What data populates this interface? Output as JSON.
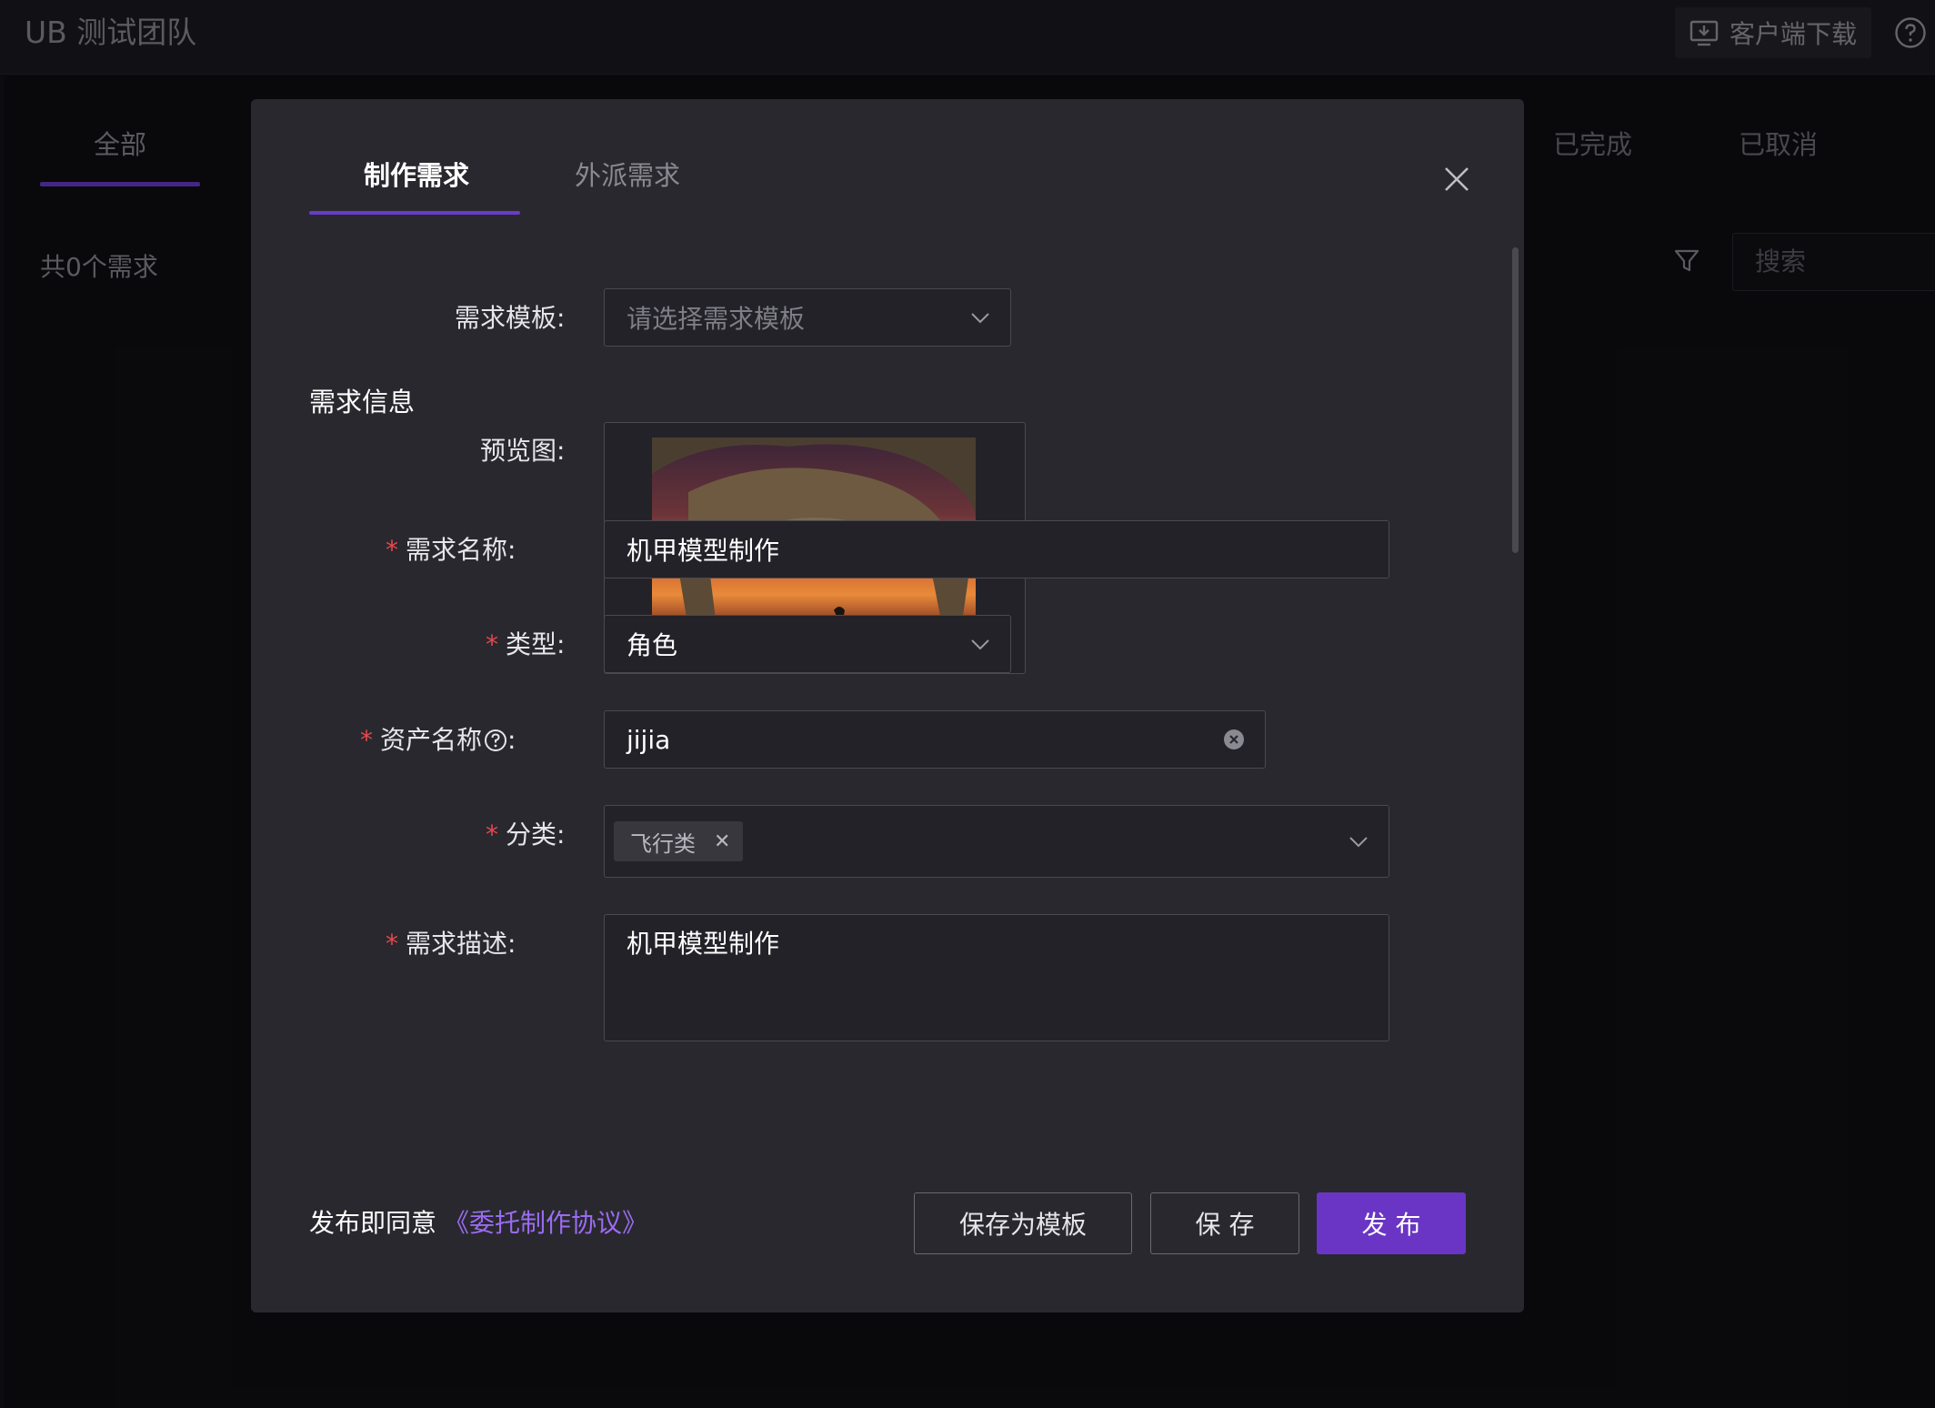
{
  "app": {
    "title": "UB 测试团队",
    "download_label": "客户端下载"
  },
  "background": {
    "tabs": {
      "all": "全部",
      "done": "已完成",
      "cancelled": "已取消"
    },
    "count_text": "共0个需求",
    "search_placeholder": "搜索"
  },
  "modal": {
    "tabs": [
      "制作需求",
      "外派需求"
    ],
    "active_tab": 0,
    "section_title": "需求信息",
    "fields": {
      "template": {
        "label": "需求模板:",
        "placeholder": "请选择需求模板"
      },
      "preview": {
        "label": "预览图:"
      },
      "name": {
        "label": "需求名称:",
        "required": true,
        "value": "机甲模型制作"
      },
      "type": {
        "label": "类型:",
        "required": true,
        "value": "角色"
      },
      "asset_name": {
        "label": "资产名称",
        "label_suffix": ":",
        "required": true,
        "value": "jijia"
      },
      "category": {
        "label": "分类:",
        "required": true,
        "tags": [
          "飞行类"
        ]
      },
      "description": {
        "label": "需求描述:",
        "required": true,
        "value": "机甲模型制作"
      }
    },
    "footer": {
      "agree_text": "发布即同意",
      "agree_link": "《委托制作协议》",
      "save_template_label": "保存为模板",
      "save_label": "保 存",
      "publish_label": "发 布"
    }
  },
  "colors": {
    "accent": "#6a35c4",
    "link": "#9a6cf0",
    "required": "#e5484d"
  }
}
